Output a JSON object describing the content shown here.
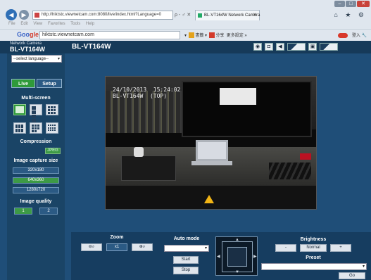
{
  "browser": {
    "window_controls": [
      "–",
      "□",
      "✕"
    ],
    "address": "http://hiktstc.viewnetcam.com:8080/live/index.html?Language=0",
    "address_tools": "ρ - ♂ ✕",
    "tab_title": "BL-VT164W Network Camera",
    "tab_close": "✕",
    "menu": [
      "File",
      "Edit",
      "View",
      "Favorites",
      "Tools",
      "Help"
    ],
    "toolbar_search_brand_a": "Goo",
    "toolbar_search_brand_b": "gle",
    "toolbar_search_value": "hiktstc.viewnetcam.com",
    "toolbar_items": [
      "▾",
      "書籤 ▾",
      "分享",
      "更多設定 »"
    ],
    "toolbar_right": "登入 🔧",
    "right_icons": "⌂ ★ ⚙"
  },
  "app": {
    "brand_small": "Network Camera",
    "model": "BL-VT164W",
    "title": "BL-VT164W",
    "language_select": "--select language--",
    "live_label": "Live",
    "setup_label": "Setup",
    "multiscreen_label": "Multi-screen",
    "compression_label": "Compression",
    "jpeg_label": "JPEG",
    "capture_size_label": "Image capture size",
    "capture_sizes": [
      "320x180",
      "640x360",
      "1280x720"
    ],
    "image_quality_label": "Image quality",
    "quality_options": [
      "1",
      "2"
    ],
    "osd_line1": "24/10/2013  15:24:02",
    "osd_line2": "BL-VT164W  (TOP)",
    "zoom_label": "Zoom",
    "zoom_reset": "x1",
    "automode_label": "Auto mode",
    "start_label": "Start",
    "stop_label": "Stop",
    "brightness_label": "Brightness",
    "brightness_minus": "-",
    "brightness_normal": "Normal",
    "brightness_plus": "+",
    "preset_label": "Preset",
    "go_label": "Go"
  }
}
